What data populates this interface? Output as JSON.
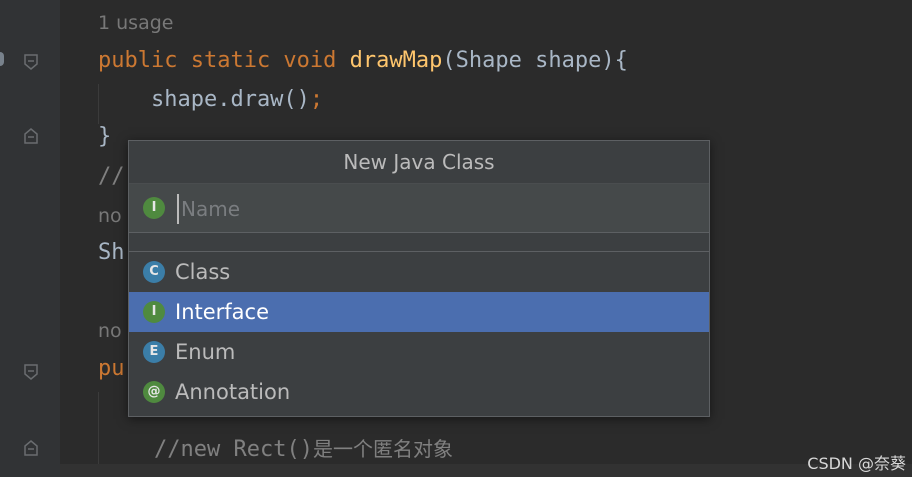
{
  "editor": {
    "usage_hint_1": "1 usage",
    "line_1": {
      "kw": "public static void ",
      "fn": "drawMap",
      "rest": "(Shape shape){"
    },
    "line_2": {
      "text": "    shape.draw()",
      "semi": ";"
    },
    "line_3": "}",
    "line_4_partial": "//",
    "usage_hint_2": "no",
    "line_5_partial": "Sh",
    "usage_hint_3": "no",
    "line_6_partial": "pu",
    "comment_line_code": "//new Rect()",
    "comment_line_cn": "是一个匿名对象"
  },
  "popup": {
    "title": "New Java Class",
    "name_placeholder": "Name",
    "name_badge": "I",
    "items": [
      {
        "label": "Class",
        "badge": "C",
        "color": "#3b7ea8",
        "selected": false
      },
      {
        "label": "Interface",
        "badge": "I",
        "color": "#4f8a3f",
        "selected": true
      },
      {
        "label": "Enum",
        "badge": "E",
        "color": "#3b7ea8",
        "selected": false
      },
      {
        "label": "Annotation",
        "badge": "@",
        "color": "#4f8a3f",
        "selected": false
      }
    ]
  },
  "colors": {
    "selection": "#4b6eaf",
    "keyword": "#cc7832",
    "function": "#ffc66d"
  },
  "watermark": "CSDN @奈葵"
}
